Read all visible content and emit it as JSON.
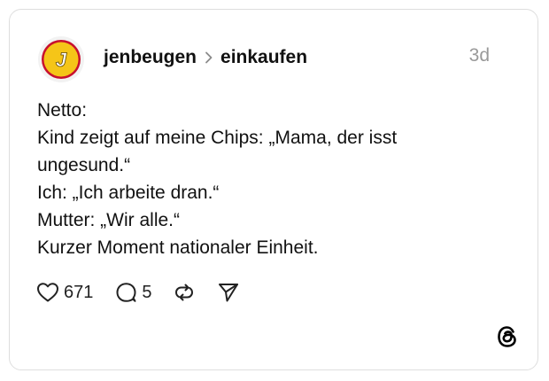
{
  "post": {
    "author": "jenbeugen",
    "community": "einkaufen",
    "timestamp": "3d",
    "avatar_letter": "J",
    "lines": [
      "Netto:",
      "Kind zeigt auf meine Chips: „Mama, der isst",
      "ungesund.“",
      "Ich: „Ich arbeite dran.“",
      "Mutter: „Wir alle.“",
      "Kurzer Moment nationaler Einheit."
    ]
  },
  "actions": {
    "likes": "671",
    "replies": "5",
    "like_icon": "heart-icon",
    "reply_icon": "comment-icon",
    "repost_icon": "repost-icon",
    "share_icon": "send-icon"
  },
  "branding": {
    "logo_icon": "threads-logo-icon"
  },
  "colors": {
    "avatar_ring": "#c8102e",
    "avatar_fill": "#f5c518",
    "text": "#111111",
    "muted": "#999999",
    "border": "#dedede"
  }
}
